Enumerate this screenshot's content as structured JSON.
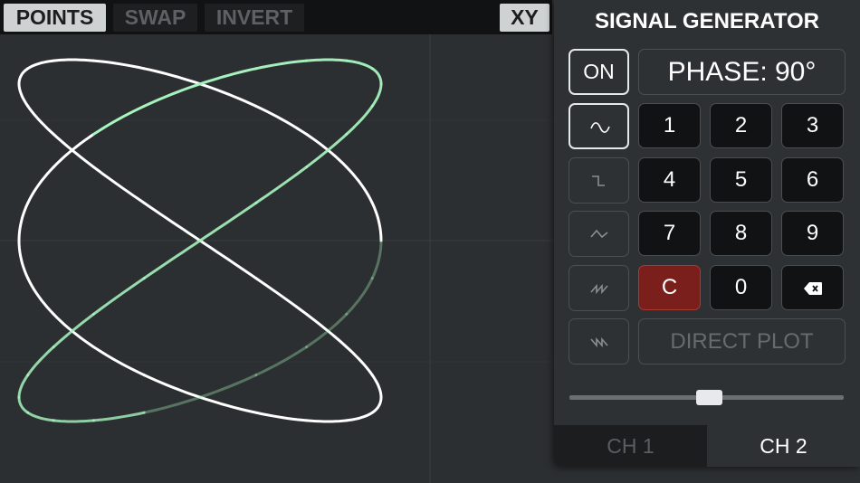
{
  "toolbar": {
    "points_label": "POINTS",
    "swap_label": "SWAP",
    "invert_label": "INVERT",
    "xy_label": "XY"
  },
  "panel": {
    "title": "SIGNAL GENERATOR",
    "on_label": "ON",
    "phase_display": "PHASE: 90°",
    "keys": [
      "1",
      "2",
      "3",
      "4",
      "5",
      "6",
      "7",
      "8",
      "9",
      "C",
      "0"
    ],
    "backspace_icon": "backspace-icon",
    "direct_plot_label": "DIRECT PLOT",
    "waveforms": [
      "sine-wave-icon",
      "square-wave-icon",
      "triangle-wave-icon",
      "sawtooth-up-icon",
      "sawtooth-down-icon"
    ],
    "selected_waveform": "sine-wave-icon",
    "slider_value": 0.5,
    "tabs": [
      "CH 1",
      "CH 2"
    ],
    "active_tab": "CH 2"
  },
  "colors": {
    "trace_bright": "#ffffff",
    "trace_green": "#a8f5c0",
    "clear_key": "#7a1f1c",
    "background": "#2c2f31"
  }
}
